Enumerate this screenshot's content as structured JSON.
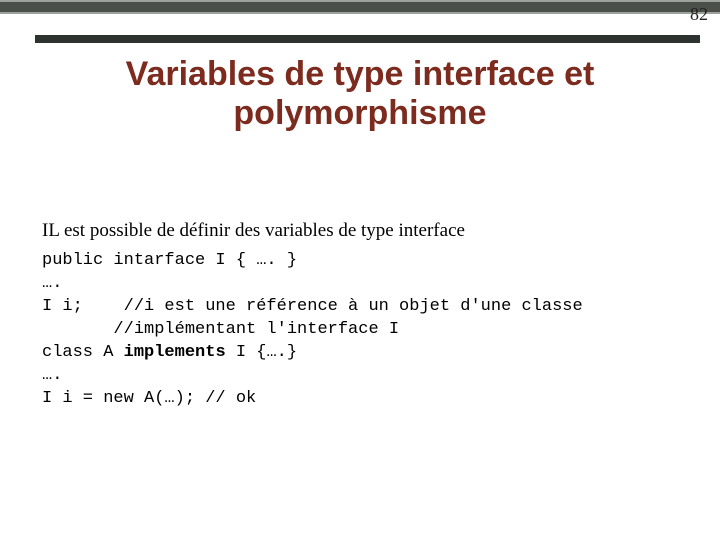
{
  "page_number": "82",
  "title": "Variables de type interface et polymorphisme",
  "lead": "IL est possible de définir des variables de type interface",
  "code": {
    "l1": "public intarface I { …. }",
    "l2": "….",
    "l3a": "I i;    //i est une référence à un objet d'une classe",
    "l3b": "       //implémentant l'interface I",
    "l4_pre": "class A ",
    "l4_kw": "implements",
    "l4_post": " I {….}",
    "l5": "….",
    "l6": "I i = new A(…); // ok"
  }
}
